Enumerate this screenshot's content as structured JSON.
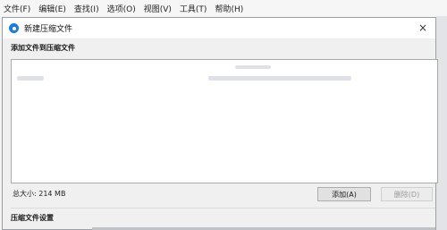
{
  "menubar": {
    "items": [
      "文件(F)",
      "编辑(E)",
      "查找(I)",
      "选项(O)",
      "视图(V)",
      "工具(T)",
      "帮助(H)"
    ]
  },
  "dialog": {
    "title": "新建压缩文件",
    "close_glyph": "×",
    "add_files_label": "添加文件到压缩文件",
    "total_size": "总大小: 214 MB",
    "add_button": "添加(A)",
    "delete_button": "删除(D)",
    "settings_label": "压缩文件设置"
  },
  "colors": {
    "accent": "#1c7ed6",
    "dialog_bg": "#f0f0f0",
    "list_bg": "#ffffff"
  }
}
